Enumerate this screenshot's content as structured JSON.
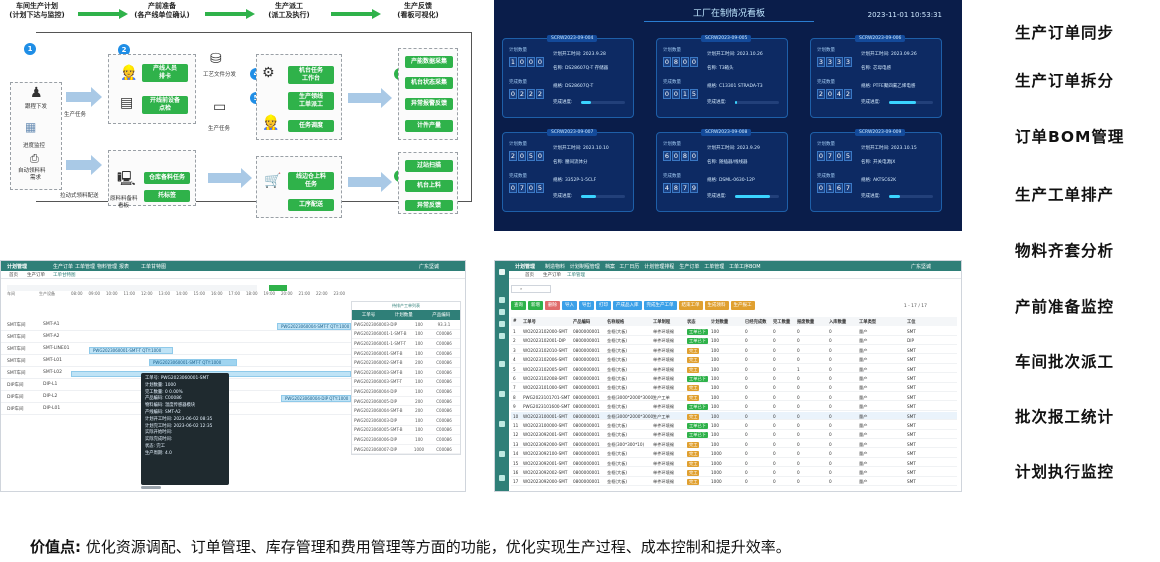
{
  "flow": {
    "stages": [
      "车间生产计划\n(计划下达与监控)",
      "产前准备\n(各产线单位确认)",
      "生产派工\n(派工及执行)",
      "生产反馈\n(看板可视化)"
    ],
    "stage_labels": [
      "车间生产计划",
      "(计划下达与监控)",
      "产前准备",
      "(各产线单位确认)",
      "生产派工",
      "(派工及执行)",
      "生产反馈",
      "(看板可视化)"
    ],
    "left_items": [
      "跟程下发",
      "进度监控",
      "自动领料料\n需求"
    ],
    "left_labels": [
      "跟程下发",
      "进度监控",
      "自动领料料",
      "需求"
    ],
    "task_label": "生产任务",
    "task_label2": "生产任务",
    "doc_label": "工艺文件分发",
    "kit_label": "原料料备料\n看板",
    "kit_label_a": "原料料备料",
    "kit_label_b": "看板",
    "auto_label": "拉动式领料配送",
    "prep_buttons": [
      "产线人员\n排卡",
      "开线前设备\n点检"
    ],
    "prep_a": [
      "产线人员",
      "排卡"
    ],
    "prep_b": [
      "开线前设备",
      "点检"
    ],
    "wh_buttons": [
      "仓库备料任务",
      "托标签"
    ],
    "dispatch_top": [
      "机台任务\n工作台",
      "生产领线\n工单派工",
      "任务调度"
    ],
    "dispatch_top_a": [
      "机台任务",
      "工作台"
    ],
    "dispatch_top_b": [
      "生产领线",
      "工单派工"
    ],
    "dispatch_top_c": "任务调度",
    "dispatch_bottom": [
      "线边仓上料\n任务",
      "工序配送"
    ],
    "dispatch_bottom_a": [
      "线边仓上料",
      "任务"
    ],
    "dispatch_bottom_b": "工序配送",
    "feedback_top": [
      "产能数据采集",
      "机台状态采集",
      "异常报警反馈",
      "计件产量"
    ],
    "feedback_bottom": [
      "过站扫描",
      "机台上料",
      "异常反馈"
    ],
    "numbers": [
      "1",
      "2",
      "3",
      "4",
      "5",
      "6",
      "7",
      "8"
    ]
  },
  "dashboard": {
    "title": "工厂在制情况看板",
    "time": "2023-11-01 10:53:31",
    "labels": {
      "plan": "计划数量",
      "done": "完成数量",
      "start": "计划开工时间:",
      "name": "名称:",
      "spec": "规格:",
      "rate": "完成进度:"
    },
    "cards": [
      {
        "id": "SCRW2023-09-004",
        "plan": "1000",
        "done": "0222",
        "start": "2023.9.28",
        "name": "DS28607Q-T 存储器",
        "spec": "DS28607Q-T",
        "progress": 0.22
      },
      {
        "id": "SCRW2023-09-005",
        "plan": "0800",
        "done": "0015",
        "start": "2023.10.26",
        "name": "T3箱头",
        "spec": "C13301 STRADA-T3",
        "progress": 0.05
      },
      {
        "id": "SCRW2023-09-006",
        "plan": "3333",
        "done": "2042",
        "start": "2023.09.26",
        "name": "芯母电感",
        "spec": "PTFE聚四氟乙烯电感",
        "progress": 0.61
      },
      {
        "id": "SCRW2023-09-007",
        "plan": "2050",
        "done": "0705",
        "start": "2023.10.10",
        "name": "腰间流体分",
        "spec": "3352P-1-5CLF",
        "progress": 0.34
      },
      {
        "id": "SCRW2023-09-008",
        "plan": "6080",
        "done": "4879",
        "start": "2023.9.29",
        "name": "随插器/线线器",
        "spec": "DSML-0630-12P",
        "progress": 0.8
      },
      {
        "id": "SCRW2023-09-009",
        "plan": "0705",
        "done": "0167",
        "start": "2023.10.15",
        "name": "开关电源JX",
        "spec": "AKTSC62K",
        "progress": 0.24
      }
    ]
  },
  "gantt": {
    "topbar": [
      "计划管理",
      "生产订单",
      "工单管理",
      "物料管理",
      "报表",
      "工单甘特图"
    ],
    "user": "广东坚诚",
    "tabs": [
      "首页",
      "生产订单",
      "工单甘特图"
    ],
    "hours": [
      "08:00",
      "09:00",
      "10:00",
      "11:00",
      "12:00",
      "13:00",
      "14:00",
      "15:00",
      "16:00",
      "17:00",
      "18:00",
      "19:00",
      "20:00",
      "21:00",
      "22:00",
      "23:00"
    ],
    "col_headers": [
      "车间",
      "生产设备"
    ],
    "rows": [
      {
        "ws": "SMT车间",
        "line": "SMT-A1"
      },
      {
        "ws": "SMT车间",
        "line": "SMT-A2"
      },
      {
        "ws": "SMT车间",
        "line": "SMT-LINE01"
      },
      {
        "ws": "SMT车间",
        "line": "SMT-L01"
      },
      {
        "ws": "SMT车间",
        "line": "SMT-L02"
      },
      {
        "ws": "DIP车间",
        "line": "DIP-L1"
      },
      {
        "ws": "DIP车间",
        "line": "DIP-L2"
      },
      {
        "ws": "DIP车间",
        "line": "DIP-L01"
      }
    ],
    "bars": [
      "PWG2023060004-SMT-T QTY:1000",
      "PWG2023060001-SMT-T QTY:1000",
      "PWG2023060001-SMT-T QTY:1000",
      "PWG2023060004-DIP QTY:1000"
    ],
    "side_title": "待排产工单列表",
    "side_headers": [
      "工单号",
      "计划数量",
      "产品编码"
    ],
    "side_rows": [
      [
        "PWG2023060003-DIP",
        "100",
        "93.3.1"
      ],
      [
        "PWG2023060001-1-SMT-B",
        "100",
        "C00086"
      ],
      [
        "PWG2023060001-1-SMT-T",
        "100",
        "C00086"
      ],
      [
        "PWG2023060001-SMT-B",
        "100",
        "C00086"
      ],
      [
        "PWG2023060002-SMT-B",
        "200",
        "C00086"
      ],
      [
        "PWG2023060003-SMT-B",
        "100",
        "C00086"
      ],
      [
        "PWG2023060003-SMT-T",
        "100",
        "C00086"
      ],
      [
        "PWG2023060004-DIP",
        "100",
        "C00086"
      ],
      [
        "PWG2023060005-DIP",
        "200",
        "C00086"
      ],
      [
        "PWG2023060004-SMT-B",
        "200",
        "C00086"
      ],
      [
        "PWG2023060003-DIP",
        "100",
        "C00086"
      ],
      [
        "PWG2023060005-SMT-B",
        "100",
        "C00086"
      ],
      [
        "PWG2023060006-DIP",
        "100",
        "C00086"
      ],
      [
        "PWG2023060007-DIP",
        "1000",
        "C00086"
      ]
    ],
    "tooltip": [
      "工单号: PWG2023060001-SMT",
      "计划数量: 1000",
      "完工数量: 0 0.00%",
      "产品编码: C00086",
      "物料编码: 温度传感器模块",
      "产线编码: SMT-A2",
      "计划开工时间: 2023-06-02 08:35",
      "计划完工时间: 2023-06-02 12:35",
      "实际开始时间:",
      "实际完成时间:",
      "状态: 完工",
      "生产周期: 4.0"
    ]
  },
  "table": {
    "topbar": [
      "计划管理",
      "制造物料",
      "计划制程管理",
      "档案",
      "工厂日历",
      "计划管理排程",
      "生产订单",
      "工单管理",
      "工单工序BOM"
    ],
    "user": "广东坚诚",
    "tabs": [
      "首页",
      "生产订单",
      "工单管理"
    ],
    "tools": [
      "查询",
      "新增",
      "删除",
      "导入",
      "导出",
      "打印",
      "产成品入库",
      "完成生产工单",
      "结束工单",
      "生成领料",
      "生产报工"
    ],
    "pagination": "1 - 17 / 17",
    "headers": [
      "#",
      "工单号",
      "产品编码",
      "名称规格",
      "工单制程",
      "状态",
      "计划数量",
      "已经完成数",
      "完工数量",
      "报废数量",
      "入库数量",
      "工单类型",
      "工位"
    ],
    "rows": [
      [
        "1",
        "WO2023102000-SMT",
        "0800000001",
        "金框(大板)",
        "单件环境锡",
        "工单已下",
        "100",
        "0",
        "0",
        "0",
        "0",
        "量产",
        "SMT"
      ],
      [
        "2",
        "WO2023102001-DIP",
        "0800000001",
        "金框(大板)",
        "单件环境锡",
        "工单已下",
        "100",
        "0",
        "0",
        "0",
        "0",
        "量产",
        "DIP"
      ],
      [
        "3",
        "WO2023102010-SMT",
        "0800000001",
        "金框(大板)",
        "单件环境锡",
        "完工",
        "100",
        "0",
        "0",
        "0",
        "0",
        "量产",
        "SMT"
      ],
      [
        "4",
        "WO2023102006-SMT",
        "0800000001",
        "金框(大板)",
        "单件环境锡",
        "完工",
        "100",
        "0",
        "0",
        "0",
        "0",
        "量产",
        "SMT"
      ],
      [
        "5",
        "WO2023102005-SMT",
        "0800000001",
        "金框(大板)",
        "单件环境锡",
        "完工",
        "100",
        "0",
        "0",
        "1",
        "0",
        "量产",
        "SMT"
      ],
      [
        "6",
        "WO2023102008-SMT",
        "0800000001",
        "金框(大板)",
        "单件环境锡",
        "工单已下",
        "100",
        "0",
        "0",
        "0",
        "0",
        "量产",
        "SMT"
      ],
      [
        "7",
        "WO2023101000-SMT",
        "0800000001",
        "金框(大板)",
        "单件环境锡",
        "完工",
        "100",
        "0",
        "0",
        "0",
        "0",
        "量产",
        "SMT"
      ],
      [
        "8",
        "PWG2023101701-SMT",
        "0800000001",
        "金框(3000*2000*3000)",
        "生产工单",
        "完工",
        "100",
        "0",
        "0",
        "0",
        "0",
        "量产",
        "SMT"
      ],
      [
        "9",
        "PWG2023101600-SMT",
        "0800000001",
        "金框(大板)",
        "单件环境锡",
        "工单已下",
        "100",
        "0",
        "0",
        "0",
        "0",
        "量产",
        "SMT"
      ],
      [
        "10",
        "WO2023100001-SMT",
        "0800000001",
        "金框(3000*2000*3000)",
        "生产工单",
        "完工",
        "100",
        "0",
        "0",
        "0",
        "0",
        "量产",
        "SMT"
      ],
      [
        "11",
        "WO2023100000-SMT",
        "0800000001",
        "金框(大板)",
        "单件环境锡",
        "工单已下",
        "100",
        "0",
        "0",
        "0",
        "0",
        "量产",
        "SMT"
      ],
      [
        "12",
        "WO2023092001-SMT",
        "0800000001",
        "金框(大板)",
        "单件环境锡",
        "工单已下",
        "100",
        "0",
        "0",
        "0",
        "0",
        "量产",
        "SMT"
      ],
      [
        "13",
        "WO2023092000-SMT",
        "0800000001",
        "金框(300*300*10)",
        "单件环境锡",
        "完工",
        "100",
        "0",
        "0",
        "0",
        "0",
        "量产",
        "SMT"
      ],
      [
        "14",
        "WO2023092100-SMT",
        "0800000001",
        "金框(大板)",
        "单件环境锡",
        "完工",
        "1000",
        "0",
        "0",
        "0",
        "0",
        "量产",
        "SMT"
      ],
      [
        "15",
        "WO2023092001-SMT",
        "0800000001",
        "金框(大板)",
        "单件环境锡",
        "完工",
        "1000",
        "0",
        "0",
        "0",
        "0",
        "量产",
        "SMT"
      ],
      [
        "16",
        "WO2023092002-SMT",
        "0800000001",
        "金框(大板)",
        "单件环境锡",
        "完工",
        "1000",
        "0",
        "0",
        "0",
        "0",
        "量产",
        "SMT"
      ],
      [
        "17",
        "WO2023092000-SMT",
        "0800000001",
        "金框(大板)",
        "单件环境锡",
        "完工",
        "1000",
        "0",
        "0",
        "0",
        "0",
        "量产",
        "SMT"
      ]
    ]
  },
  "features": [
    "生产订单同步",
    "生产订单拆分",
    "订单BOM管理",
    "生产工单排产",
    "物料齐套分析",
    "产前准备监控",
    "车间批次派工",
    "批次报工统计",
    "计划执行监控"
  ],
  "value": {
    "label": "价值点:",
    "text": "优化资源调配、订单管理、库存管理和费用管理等方面的功能，优化实现生产过程、成本控制和提升效率。"
  },
  "colors": {
    "green": "#2fb24a",
    "blue": "#1f8ee6",
    "dash_bg": "#0a1d4a",
    "teal": "#2f7f78"
  }
}
